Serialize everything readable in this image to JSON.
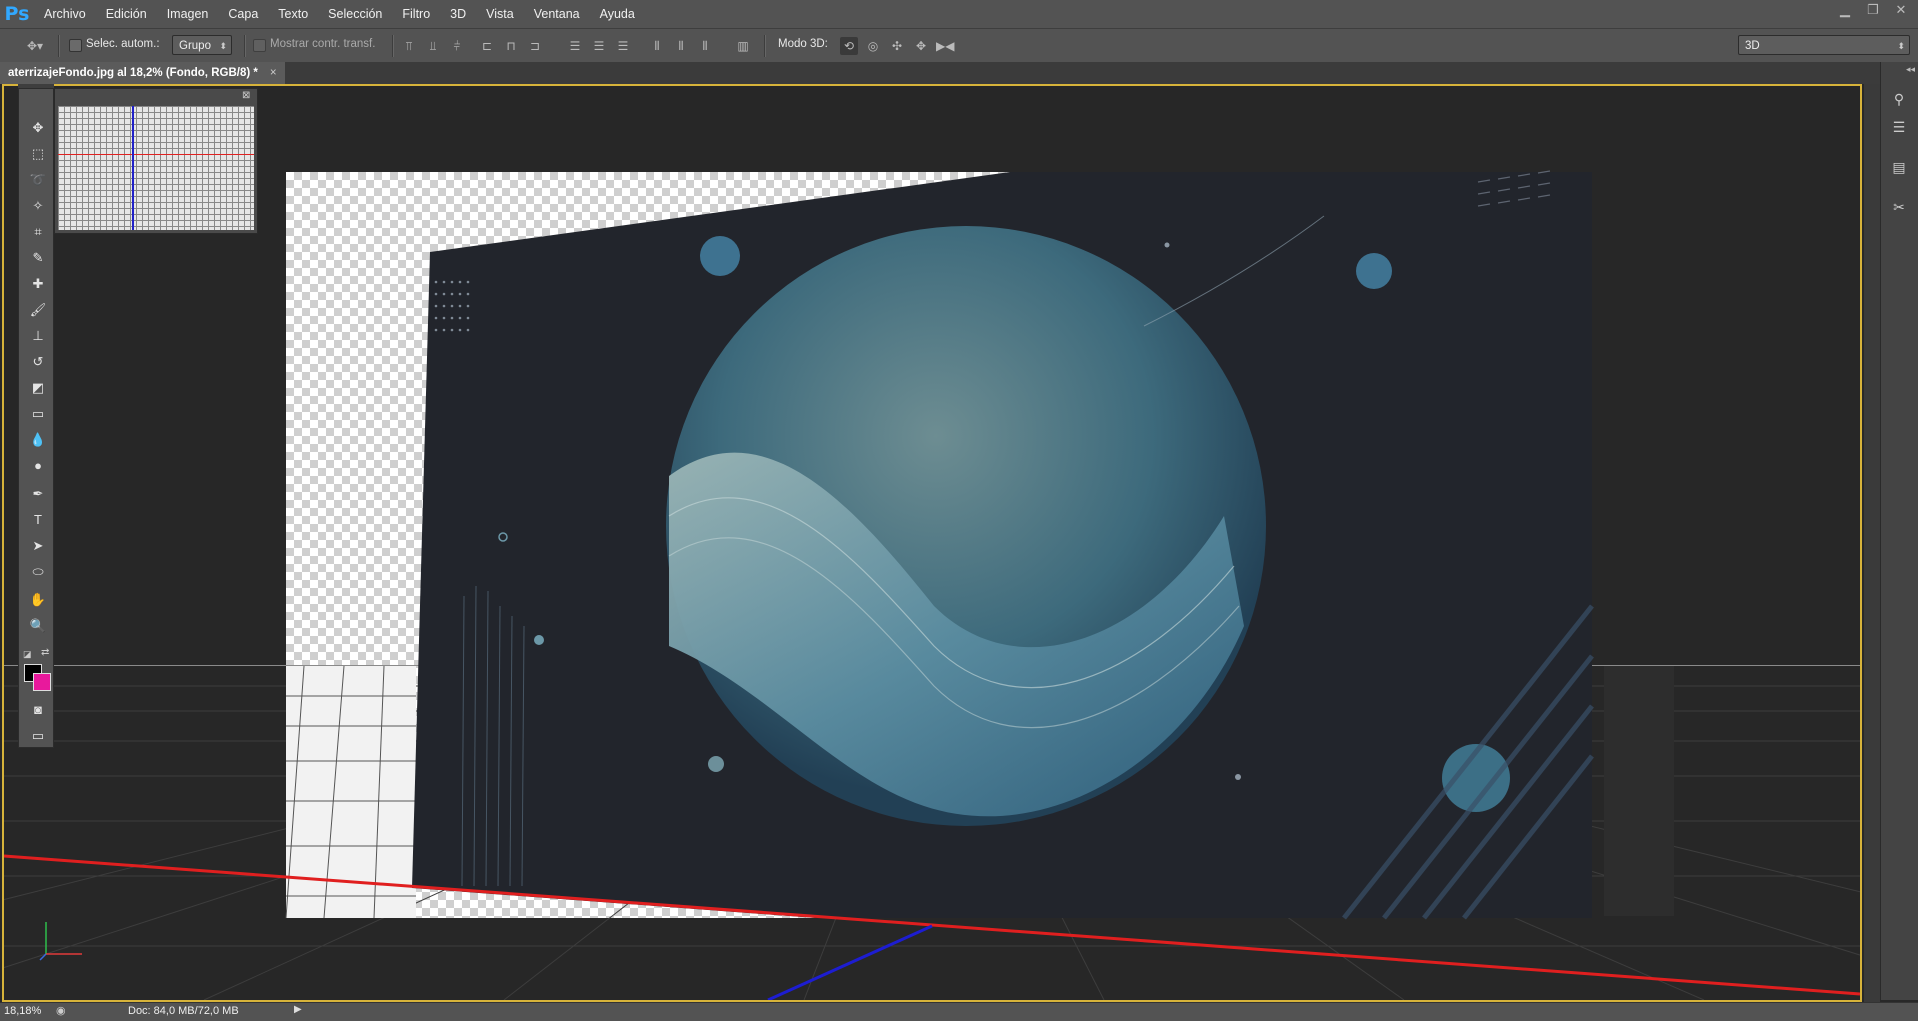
{
  "app": {
    "logo": "Ps"
  },
  "menu": [
    "Archivo",
    "Edición",
    "Imagen",
    "Capa",
    "Texto",
    "Selección",
    "Filtro",
    "3D",
    "Vista",
    "Ventana",
    "Ayuda"
  ],
  "options": {
    "auto_select_label": "Selec. autom.:",
    "auto_select_value": "Grupo",
    "transform_label": "Mostrar contr. transf.",
    "mode3d_label": "Modo 3D:",
    "workspace_value": "3D"
  },
  "document": {
    "tab_title": "aterrizajeFondo.jpg al 18,2% (Fondo, RGB/8) *",
    "close": "×"
  },
  "status": {
    "zoom": "18,18%",
    "doc_size": "Doc: 84,0 MB/72,0 MB"
  },
  "colors": {
    "foreground": "#000000",
    "background": "#e8199c",
    "accent_frame": "#d7b33a"
  }
}
